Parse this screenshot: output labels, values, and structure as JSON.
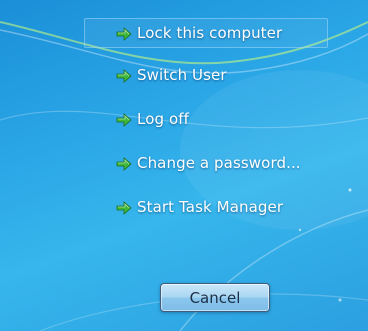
{
  "menu": {
    "options": [
      {
        "label": "Lock this computer",
        "icon": "green-arrow-icon"
      },
      {
        "label": "Switch User",
        "icon": "green-arrow-icon"
      },
      {
        "label": "Log off",
        "icon": "green-arrow-icon"
      },
      {
        "label": "Change a password...",
        "icon": "green-arrow-icon"
      },
      {
        "label": "Start Task Manager",
        "icon": "green-arrow-icon"
      }
    ]
  },
  "cancel_button": {
    "label": "Cancel"
  },
  "colors": {
    "background": "#2aa6e6",
    "arrow": "#3fb83a",
    "text": "#ffffff"
  }
}
